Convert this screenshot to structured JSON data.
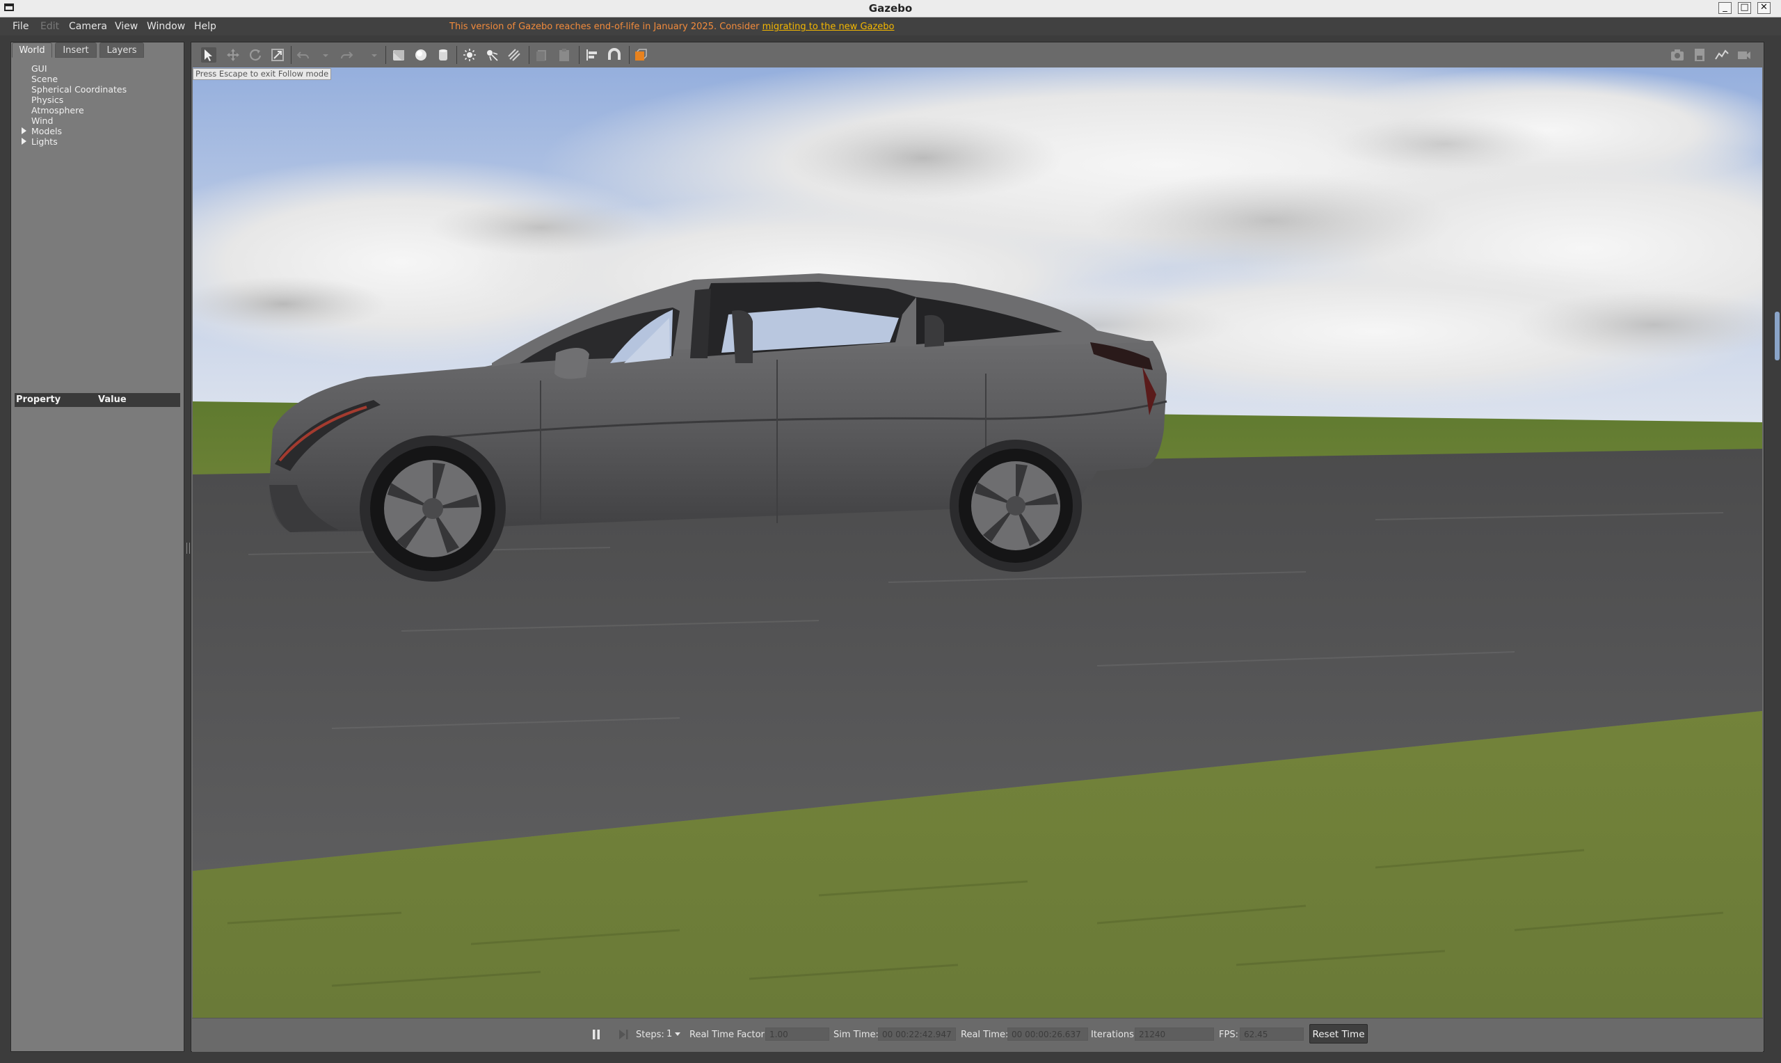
{
  "window": {
    "title": "Gazebo",
    "minimize": "_",
    "maximize": "□",
    "close": "✕"
  },
  "menu": {
    "items": [
      "File",
      "Edit",
      "Camera",
      "View",
      "Window",
      "Help"
    ],
    "notice_text": "This version of Gazebo reaches end-of-life in January 2025. Consider ",
    "notice_link": "migrating to the new Gazebo"
  },
  "left_panel": {
    "tabs": [
      "World",
      "Insert",
      "Layers"
    ],
    "active_tab": "World",
    "tree": [
      "GUI",
      "Scene",
      "Spherical Coordinates",
      "Physics",
      "Atmosphere",
      "Wind",
      "Models",
      "Lights"
    ],
    "property_header": {
      "property": "Property",
      "value": "Value"
    }
  },
  "toolbar": {
    "tools": [
      "select-arrow-icon",
      "translate-icon",
      "rotate-icon",
      "scale-icon",
      "undo-icon",
      "undo-dropdown-icon",
      "redo-icon",
      "redo-dropdown-icon",
      "box-icon",
      "sphere-icon",
      "cylinder-icon",
      "point-light-icon",
      "spot-light-icon",
      "directional-light-icon",
      "copy-icon",
      "paste-icon",
      "align-icon",
      "snap-icon",
      "view-angle-icon"
    ],
    "right_tools": [
      "screenshot-icon",
      "log-icon",
      "plot-icon",
      "record-video-icon"
    ]
  },
  "viewport": {
    "hint": "Press Escape to exit Follow mode",
    "colors": {
      "sky": "#a9bde0",
      "grass": "#6e7f39",
      "road": "#4d4d4f",
      "car": "#5a5a5c"
    }
  },
  "bottom": {
    "steps_label": "Steps:",
    "steps_value": "1",
    "rtf_label": "Real Time Factor:",
    "rtf_value": "1.00",
    "sim_label": "Sim Time:",
    "sim_value": "00 00:22:42.947",
    "real_label": "Real Time:",
    "real_value": "00 00:00:26.637",
    "iter_label": "Iterations:",
    "iter_value": "21240",
    "fps_label": "FPS:",
    "fps_value": "62.45",
    "reset_label": "Reset Time"
  }
}
